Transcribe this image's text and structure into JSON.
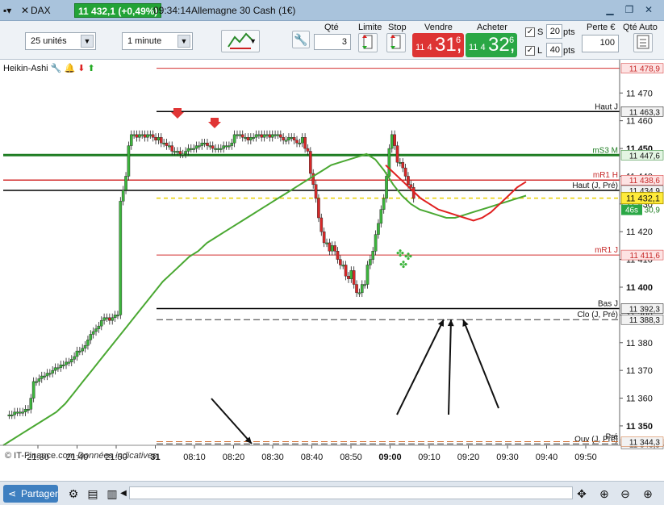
{
  "titlebar": {
    "instrument": "DAX",
    "price_change": "11 432,1 (+0,49%)",
    "time": "09:34:14",
    "market": "Allemagne 30 Cash (1€)"
  },
  "toolbar": {
    "units_select": "25 unités",
    "interval_select": "1 minute",
    "qty_label": "Qté",
    "qty_value": "3",
    "limit_label": "Limite",
    "stop_label": "Stop",
    "sell_label": "Vendre",
    "buy_label": "Acheter",
    "sell_small": "11 4",
    "sell_big": "31,",
    "sell_sup": "6",
    "buy_small": "11 4",
    "buy_big": "32,",
    "buy_sup": "6",
    "s_label": "S",
    "s_value": "20",
    "s_unit": "pts",
    "l_label": "L",
    "l_value": "40",
    "l_unit": "pts",
    "perte_label": "Perte €",
    "perte_value": "100",
    "qte_auto_label": "Qté Auto",
    "colors": {
      "sell": "#dd3333",
      "buy": "#2aa745",
      "badge": "#22a336"
    }
  },
  "indicator_label": "Heikin-Ashi",
  "chart_data": {
    "type": "candlestick",
    "title": "",
    "price_axis": {
      "min": 11343,
      "max": 11482,
      "ticks": [
        11470,
        11460,
        11450,
        11440,
        11430,
        11420,
        11410,
        11400,
        11390,
        11380,
        11370,
        11360,
        11350
      ],
      "tick_labels": [
        "11 470",
        "11 460",
        "11 450",
        "11 440",
        "11 430",
        "11 420",
        "11 410",
        "11 400",
        "11 390",
        "11 380",
        "11 370",
        "11 360",
        "11 350"
      ],
      "bold_ticks": [
        "11 450",
        "11 400",
        "11 350"
      ]
    },
    "time_axis": {
      "labels": [
        "21:30",
        "21:40",
        "21:50",
        "31",
        "08:10",
        "08:20",
        "08:30",
        "08:40",
        "08:50",
        "09:00",
        "09:10",
        "09:20",
        "09:30",
        "09:40",
        "09:50"
      ],
      "bold_labels": [
        "31",
        "09:00"
      ]
    },
    "levels": [
      {
        "name": "",
        "value": "11 478,9",
        "y": 11478.9,
        "color": "#d32f2f",
        "style": "solid",
        "width": 1
      },
      {
        "name": "Haut J",
        "value": "11 463,3",
        "y": 11463.3,
        "color": "#000000",
        "style": "solid",
        "width": 1.5
      },
      {
        "name": "mS3 M",
        "value": "11 447,6",
        "y": 11447.6,
        "color": "#1e7d22",
        "style": "solid",
        "width": 3
      },
      {
        "name": "mR1 H",
        "value": "11 438,6",
        "y": 11438.6,
        "color": "#d32f2f",
        "style": "solid",
        "width": 1.5
      },
      {
        "name": "Haut (J, Pré)",
        "value": "11 434,9",
        "y": 11434.9,
        "color": "#333333",
        "style": "dashed",
        "width": 1
      },
      {
        "name": "",
        "value": "11 434,9",
        "y": 11434.9,
        "color": "#000000",
        "style": "solid",
        "width": 1.5
      },
      {
        "name": "mR1 J",
        "value": "11 411,6",
        "y": 11411.6,
        "color": "#d32f2f",
        "style": "solid",
        "width": 1
      },
      {
        "name": "Bas J",
        "value": "11 392,3",
        "y": 11392.3,
        "color": "#000000",
        "style": "solid",
        "width": 1.5
      },
      {
        "name": "Clo (J, Pré)",
        "value": "11 388,3",
        "y": 11388.3,
        "color": "#333333",
        "style": "dashed",
        "width": 1
      },
      {
        "name": "Ouv (J, Pré)",
        "value": "11 343,5",
        "y": 11343.5,
        "color": "#333333",
        "style": "dashed",
        "width": 1
      },
      {
        "name": "Pré",
        "value": "11 344,3",
        "y": 11344.3,
        "color": "#d06a2a",
        "style": "dashed",
        "width": 1
      }
    ],
    "current_price": {
      "value": "11 432,1",
      "y": 11432.1,
      "timer": "46s",
      "color": "#e8d000"
    },
    "hidden_label": "30,9",
    "series": [
      {
        "name": "",
        "type": "candles",
        "x": [
          0,
          1,
          2,
          3,
          4,
          5,
          6,
          7,
          8,
          9,
          10,
          11,
          12,
          13,
          14,
          15,
          16,
          17,
          18,
          19,
          20,
          21,
          22,
          23,
          24,
          25,
          26,
          27,
          28,
          29,
          30,
          31,
          32,
          33,
          34,
          35,
          36,
          37,
          38,
          39,
          40,
          41,
          42,
          43,
          44,
          45,
          46,
          47,
          48,
          49,
          50,
          51,
          52,
          53,
          54,
          55,
          56,
          57,
          58,
          59,
          60,
          61,
          62,
          63,
          64,
          65,
          66,
          67,
          68,
          69,
          70,
          71,
          72,
          73,
          74,
          75,
          76,
          77,
          78,
          79,
          80,
          81,
          82,
          83,
          84,
          85,
          86,
          87,
          88,
          89,
          90,
          91,
          92,
          93,
          94,
          95,
          96,
          97,
          98,
          99,
          100,
          101,
          102,
          103,
          104,
          105,
          106,
          107,
          108,
          109,
          110,
          111,
          112,
          113,
          114,
          115,
          116,
          117,
          118,
          119,
          120,
          121,
          122,
          123,
          124,
          125,
          126,
          127,
          128,
          129,
          130,
          131,
          132,
          133,
          134,
          135,
          136,
          137,
          138,
          139,
          140,
          141,
          142,
          143,
          144,
          145,
          146,
          147,
          148,
          149,
          150,
          151,
          152,
          153,
          154,
          155,
          156,
          157,
          158,
          159,
          160,
          161,
          162,
          163,
          164,
          165,
          166,
          167,
          168,
          169,
          170,
          171,
          172,
          173,
          174,
          175,
          176,
          177,
          178,
          179,
          180,
          181,
          182,
          183,
          184,
          185,
          186,
          187,
          188,
          189,
          190,
          191,
          192
        ],
        "close": [
          11354,
          11354,
          11354,
          11355,
          11355,
          11355,
          11355,
          11356,
          11356,
          11360,
          11366,
          11366,
          11367,
          11368,
          11368,
          11369,
          11369,
          11370,
          11371,
          11371,
          11372,
          11372,
          11373,
          11373,
          11374,
          11375,
          11377,
          11377,
          11378,
          11379,
          11381,
          11383,
          11384,
          11385,
          11386,
          11388,
          11389,
          11389,
          11388,
          11389,
          11390,
          11390,
          11431,
          11435,
          11440,
          11451,
          11455,
          11455,
          11454,
          11455,
          11455,
          11454,
          11455,
          11455,
          11454,
          11453,
          11454,
          11452,
          11452,
          11451,
          11451,
          11449,
          11449,
          11449,
          11448,
          11448,
          11449,
          11450,
          11450,
          11450,
          11451,
          11451,
          11452,
          11452,
          11451,
          11451,
          11450,
          11450,
          11450,
          11450,
          11451,
          11451,
          11451,
          11452,
          11455,
          11455,
          11455,
          11454,
          11454,
          11453,
          11454,
          11454,
          11455,
          11455,
          11454,
          11455,
          11455,
          11454,
          11455,
          11455,
          11455,
          11454,
          11453,
          11453,
          11454,
          11454,
          11453,
          11452,
          11452,
          11454,
          11450,
          11449,
          11441,
          11437,
          11432,
          11425,
          11420,
          11416,
          11416,
          11413,
          11415,
          11413,
          11410,
          11408,
          11408,
          11404,
          11403,
          11406,
          11401,
          11398,
          11398,
          11401,
          11401,
          11408,
          11410,
          11413,
          11419,
          11423,
          11428,
          11432,
          11440,
          11450,
          11455,
          11451,
          11445,
          11445,
          11443,
          11440,
          11437,
          11436,
          11432
        ]
      },
      {
        "name": "",
        "type": "line",
        "color": "#4aa832",
        "y": [
          11343,
          11345,
          11347,
          11349,
          11351,
          11353,
          11355,
          11358,
          11362,
          11366,
          11370,
          11374,
          11378,
          11382,
          11386,
          11390,
          11394,
          11398,
          11402,
          11405,
          11408,
          11411,
          11413,
          11416,
          11418,
          11420,
          11422,
          11424,
          11426,
          11428,
          11430,
          11432,
          11434,
          11436,
          11438,
          11440,
          11442,
          11444,
          11445,
          11446,
          11447,
          11448,
          11446,
          11442,
          11437,
          11433,
          11430,
          11428,
          11427,
          11426,
          11425,
          11425,
          11426,
          11427,
          11428,
          11429,
          11430,
          11431,
          11432,
          11433
        ]
      },
      {
        "name": "",
        "type": "line",
        "color": "#e02020",
        "y": [
          11444,
          11441,
          11438,
          11435,
          11432,
          11430,
          11428,
          11427,
          11426,
          11425,
          11424,
          11425,
          11427,
          11430,
          11433,
          11436,
          11438
        ]
      }
    ],
    "arrows": {
      "down_count": 2,
      "up_count": 0
    }
  }
}
